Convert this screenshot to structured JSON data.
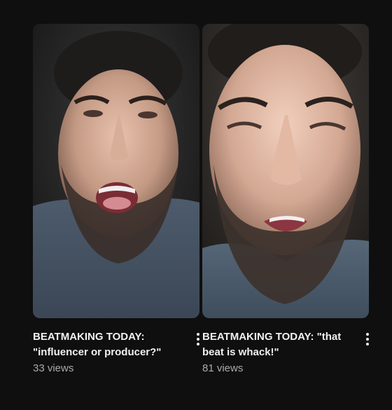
{
  "videos": [
    {
      "title": "BEATMAKING TODAY: \"influencer or producer?\"",
      "views": "33 views",
      "menu_icon": "more-vert-icon",
      "thumbnail_subject": "man-selfie-mouth-open"
    },
    {
      "title": "BEATMAKING TODAY: \"that beat is whack!\"",
      "views": "81 views",
      "menu_icon": "more-vert-icon",
      "thumbnail_subject": "man-selfie-squinting"
    }
  ],
  "colors": {
    "background": "#0f0f0f",
    "title": "#f1f1f1",
    "meta": "#aaaaaa"
  }
}
